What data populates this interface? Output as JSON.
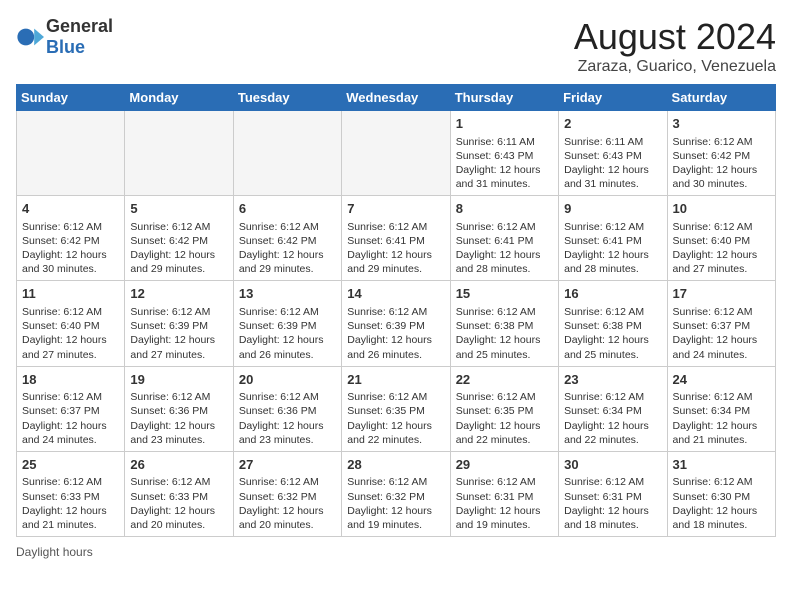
{
  "header": {
    "logo_general": "General",
    "logo_blue": "Blue",
    "title": "August 2024",
    "subtitle": "Zaraza, Guarico, Venezuela"
  },
  "days_of_week": [
    "Sunday",
    "Monday",
    "Tuesday",
    "Wednesday",
    "Thursday",
    "Friday",
    "Saturday"
  ],
  "weeks": [
    [
      {
        "day": "",
        "empty": true
      },
      {
        "day": "",
        "empty": true
      },
      {
        "day": "",
        "empty": true
      },
      {
        "day": "",
        "empty": true
      },
      {
        "day": "1",
        "sunrise": "6:11 AM",
        "sunset": "6:43 PM",
        "daylight": "12 hours and 31 minutes."
      },
      {
        "day": "2",
        "sunrise": "6:11 AM",
        "sunset": "6:43 PM",
        "daylight": "12 hours and 31 minutes."
      },
      {
        "day": "3",
        "sunrise": "6:12 AM",
        "sunset": "6:42 PM",
        "daylight": "12 hours and 30 minutes."
      }
    ],
    [
      {
        "day": "4",
        "sunrise": "6:12 AM",
        "sunset": "6:42 PM",
        "daylight": "12 hours and 30 minutes."
      },
      {
        "day": "5",
        "sunrise": "6:12 AM",
        "sunset": "6:42 PM",
        "daylight": "12 hours and 29 minutes."
      },
      {
        "day": "6",
        "sunrise": "6:12 AM",
        "sunset": "6:42 PM",
        "daylight": "12 hours and 29 minutes."
      },
      {
        "day": "7",
        "sunrise": "6:12 AM",
        "sunset": "6:41 PM",
        "daylight": "12 hours and 29 minutes."
      },
      {
        "day": "8",
        "sunrise": "6:12 AM",
        "sunset": "6:41 PM",
        "daylight": "12 hours and 28 minutes."
      },
      {
        "day": "9",
        "sunrise": "6:12 AM",
        "sunset": "6:41 PM",
        "daylight": "12 hours and 28 minutes."
      },
      {
        "day": "10",
        "sunrise": "6:12 AM",
        "sunset": "6:40 PM",
        "daylight": "12 hours and 27 minutes."
      }
    ],
    [
      {
        "day": "11",
        "sunrise": "6:12 AM",
        "sunset": "6:40 PM",
        "daylight": "12 hours and 27 minutes."
      },
      {
        "day": "12",
        "sunrise": "6:12 AM",
        "sunset": "6:39 PM",
        "daylight": "12 hours and 27 minutes."
      },
      {
        "day": "13",
        "sunrise": "6:12 AM",
        "sunset": "6:39 PM",
        "daylight": "12 hours and 26 minutes."
      },
      {
        "day": "14",
        "sunrise": "6:12 AM",
        "sunset": "6:39 PM",
        "daylight": "12 hours and 26 minutes."
      },
      {
        "day": "15",
        "sunrise": "6:12 AM",
        "sunset": "6:38 PM",
        "daylight": "12 hours and 25 minutes."
      },
      {
        "day": "16",
        "sunrise": "6:12 AM",
        "sunset": "6:38 PM",
        "daylight": "12 hours and 25 minutes."
      },
      {
        "day": "17",
        "sunrise": "6:12 AM",
        "sunset": "6:37 PM",
        "daylight": "12 hours and 24 minutes."
      }
    ],
    [
      {
        "day": "18",
        "sunrise": "6:12 AM",
        "sunset": "6:37 PM",
        "daylight": "12 hours and 24 minutes."
      },
      {
        "day": "19",
        "sunrise": "6:12 AM",
        "sunset": "6:36 PM",
        "daylight": "12 hours and 23 minutes."
      },
      {
        "day": "20",
        "sunrise": "6:12 AM",
        "sunset": "6:36 PM",
        "daylight": "12 hours and 23 minutes."
      },
      {
        "day": "21",
        "sunrise": "6:12 AM",
        "sunset": "6:35 PM",
        "daylight": "12 hours and 22 minutes."
      },
      {
        "day": "22",
        "sunrise": "6:12 AM",
        "sunset": "6:35 PM",
        "daylight": "12 hours and 22 minutes."
      },
      {
        "day": "23",
        "sunrise": "6:12 AM",
        "sunset": "6:34 PM",
        "daylight": "12 hours and 22 minutes."
      },
      {
        "day": "24",
        "sunrise": "6:12 AM",
        "sunset": "6:34 PM",
        "daylight": "12 hours and 21 minutes."
      }
    ],
    [
      {
        "day": "25",
        "sunrise": "6:12 AM",
        "sunset": "6:33 PM",
        "daylight": "12 hours and 21 minutes."
      },
      {
        "day": "26",
        "sunrise": "6:12 AM",
        "sunset": "6:33 PM",
        "daylight": "12 hours and 20 minutes."
      },
      {
        "day": "27",
        "sunrise": "6:12 AM",
        "sunset": "6:32 PM",
        "daylight": "12 hours and 20 minutes."
      },
      {
        "day": "28",
        "sunrise": "6:12 AM",
        "sunset": "6:32 PM",
        "daylight": "12 hours and 19 minutes."
      },
      {
        "day": "29",
        "sunrise": "6:12 AM",
        "sunset": "6:31 PM",
        "daylight": "12 hours and 19 minutes."
      },
      {
        "day": "30",
        "sunrise": "6:12 AM",
        "sunset": "6:31 PM",
        "daylight": "12 hours and 18 minutes."
      },
      {
        "day": "31",
        "sunrise": "6:12 AM",
        "sunset": "6:30 PM",
        "daylight": "12 hours and 18 minutes."
      }
    ]
  ],
  "legend": {
    "daylight_hours_label": "Daylight hours"
  }
}
